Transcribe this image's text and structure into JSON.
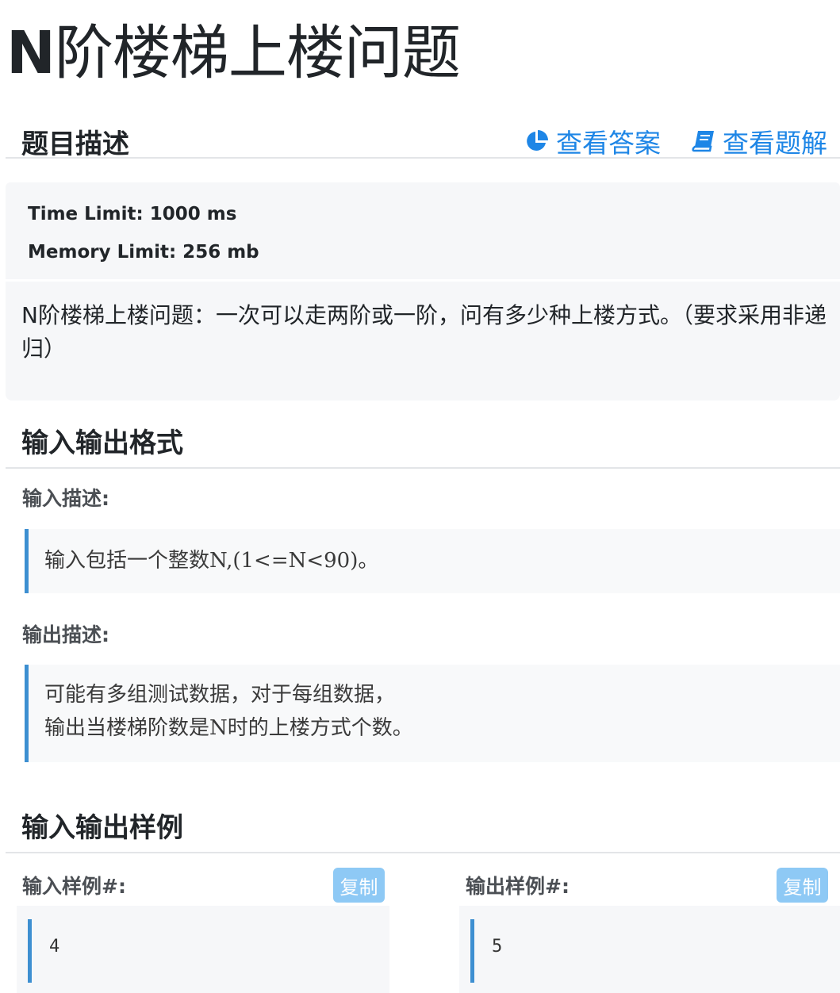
{
  "page": {
    "title_prefix": "N",
    "title_rest": "阶楼梯上楼问题"
  },
  "problem": {
    "heading": "题目描述",
    "view_answer_label": "查看答案",
    "view_solution_label": "查看题解",
    "time_limit": "Time Limit: 1000 ms",
    "memory_limit": "Memory Limit: 256 mb",
    "description": "N阶楼梯上楼问题：一次可以走两阶或一阶，问有多少种上楼方式。（要求采用非递归）"
  },
  "io_format": {
    "heading": "输入输出格式",
    "input_label": "输入描述:",
    "input_text": "输入包括一个整数N,(1<=N<90)。",
    "output_label": "输出描述:",
    "output_text": "可能有多组测试数据，对于每组数据，\n输出当楼梯阶数是N时的上楼方式个数。"
  },
  "samples": {
    "heading": "输入输出样例",
    "input_label": "输入样例#:",
    "output_label": "输出样例#:",
    "copy_label": "复制",
    "input_value": "4",
    "output_value": "5"
  },
  "icons": {
    "answer": "pie-chart-icon",
    "solution": "book-icon"
  },
  "colors": {
    "link": "#1e86e6",
    "copy_button": "#8ec9f5",
    "quote_border": "#3d8fd1"
  }
}
